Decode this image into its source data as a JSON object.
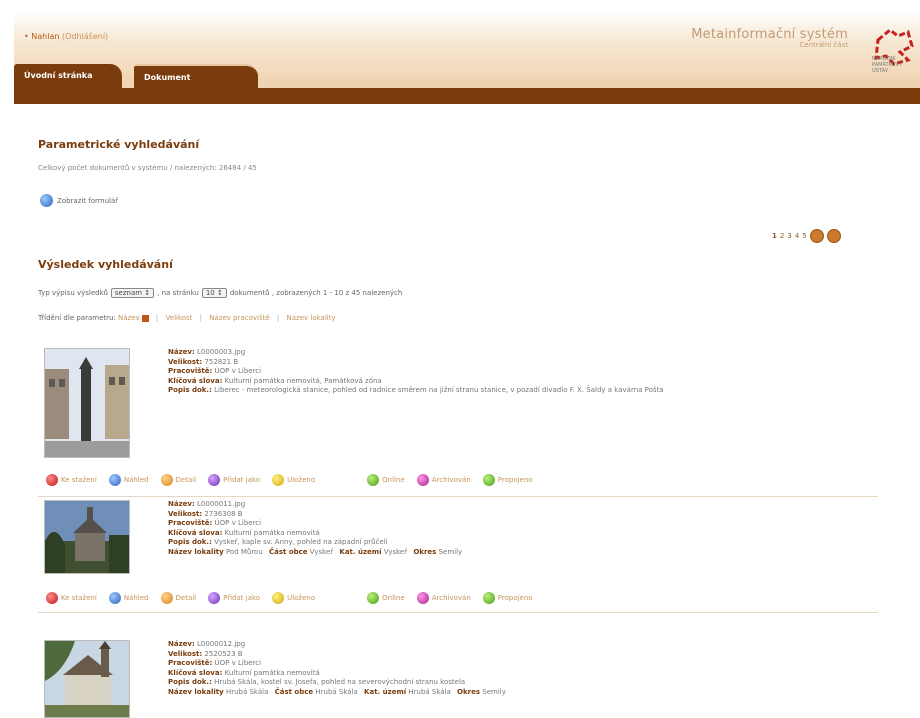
{
  "header": {
    "user_prefix": "• Nahlan",
    "user_action": "(Odhlášení)",
    "system_title": "Metainformační systém",
    "system_subtitle": "Centrální část",
    "logo_text": "NÁRODNÍ PAMÁTKOVÝ ÚSTAV",
    "tabs": [
      {
        "label": "Úvodní stránka"
      },
      {
        "label": "Dokument"
      }
    ]
  },
  "search": {
    "title": "Parametrické vyhledávání",
    "count_text": "Celkový počet dokumentů v systému / nalezených: 26484 / 45",
    "reset_label": "Zobrazit formulář"
  },
  "pagination": {
    "pages": [
      "1",
      "2",
      "3",
      "4",
      "5"
    ],
    "current": "1"
  },
  "results_header": {
    "title": "Výsledek vyhledávání",
    "type_label": "Typ výpisu výsledků",
    "type_value": "seznam",
    "per_page_label": ", na stránku",
    "per_page_value": "10",
    "summary": "dokumentů , zobrazených 1 - 10 z 45 nalezených",
    "sort_label": "Třídění dle parametru:",
    "sort_options": [
      "Název",
      "Velikost",
      "Název pracoviště",
      "Název lokality"
    ]
  },
  "actions": {
    "download": "Ke stažení",
    "preview": "Náhled",
    "detail": "Detail",
    "add_as": "Přidat jako",
    "saved": "Uloženo",
    "online": "Online",
    "archived": "Archivován",
    "linked": "Propojeno"
  },
  "labels": {
    "name": "Název:",
    "size": "Velikost:",
    "workplace": "Pracoviště:",
    "keywords": "Klíčová slova:",
    "description": "Popis dok.:",
    "locality": "Název lokality",
    "place_part": "Část obce",
    "cadastre": "Kat. území",
    "district": "Okres"
  },
  "results": [
    {
      "name": "L0000003.jpg",
      "size": "752821 B",
      "workplace": "ÚOP v Liberci",
      "keywords": "Kulturní památka nemovitá, Památková zóna",
      "description": "Liberec - meteorologická stanice, pohled od radnice směrem na jižní stranu stanice, v pozadí divadlo F. X. Šaldy a kavárna Pošta"
    },
    {
      "name": "L0000011.jpg",
      "size": "2736308 B",
      "workplace": "ÚOP v Liberci",
      "keywords": "Kulturní památka nemovitá",
      "description": "Vyskeř, kaple sv. Anny, pohled na západní průčelí",
      "locality": "Pod Můrou",
      "place_part": "Vyskeř",
      "cadastre": "Vyskeř",
      "district": "Semily"
    },
    {
      "name": "L0000012.jpg",
      "size": "2520523 B",
      "workplace": "ÚOP v Liberci",
      "keywords": "Kulturní památka nemovitá",
      "description": "Hrubá Skála, kostel sv. Josefa, pohled na severovýchodní stranu kostela",
      "locality": "Hrubá Skála",
      "place_part": "Hrubá Skála",
      "cadastre": "Hrubá Skála",
      "district": "Semily"
    }
  ]
}
